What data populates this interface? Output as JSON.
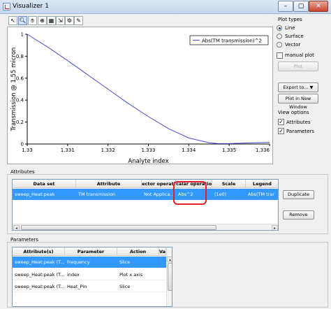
{
  "window": {
    "title": "Visualizer 1",
    "min": "–",
    "max": "▢",
    "close": "✕"
  },
  "toolbar": {
    "icons": [
      "select",
      "zoom",
      "pan",
      "copy",
      "image",
      "export",
      "settings",
      "edit"
    ]
  },
  "chart_data": {
    "type": "line",
    "xlabel": "Analyte index",
    "ylabel": "Transmission @ 1.55 micron",
    "xlim": [
      1.33,
      1.336
    ],
    "ylim": [
      0,
      1
    ],
    "xticks": [
      "1.33",
      "1.331",
      "1.332",
      "1.333",
      "1.334",
      "1.335",
      "1.336"
    ],
    "yticks": [
      "0",
      "0.2",
      "0.4",
      "0.6",
      "0.8",
      "1"
    ],
    "legend_position": "top-right",
    "series": [
      {
        "name": "Abs(TM transmission)^2",
        "color": "#4b4bd6",
        "x": [
          1.33,
          1.3305,
          1.331,
          1.3315,
          1.332,
          1.3325,
          1.333,
          1.3335,
          1.334,
          1.3345,
          1.3347,
          1.335,
          1.3355,
          1.336
        ],
        "y": [
          1.0,
          0.885,
          0.76,
          0.63,
          0.5,
          0.37,
          0.25,
          0.14,
          0.055,
          0.012,
          0.005,
          0.004,
          0.01,
          0.015
        ]
      }
    ]
  },
  "plot_types": {
    "label": "Plot types",
    "options": [
      "Line",
      "Surface",
      "Vector"
    ],
    "selected": "Line",
    "manual_plot": "manual plot",
    "plot_button": "Plot"
  },
  "actions": {
    "export": "Export to... ▼",
    "new_window": "Plot in New Window"
  },
  "view_options": {
    "label": "View options",
    "items": [
      {
        "label": "Attributes",
        "checked": true
      },
      {
        "label": "Parameters",
        "checked": true
      }
    ]
  },
  "attributes": {
    "label": "Attributes",
    "headers": [
      "Data set",
      "Attribute",
      "ector operati",
      "calar operatio",
      "Scale",
      "Legend"
    ],
    "rows": [
      [
        "sweep_Heat:peak",
        "TM transmission",
        "Not Applica...",
        "Abs^2",
        "(1e0)",
        "Abs(TM trar"
      ]
    ],
    "duplicate": "Duplicate",
    "remove": "Remove"
  },
  "parameters": {
    "label": "Parameters",
    "headers": [
      "Attribute(s)",
      "Parameter",
      "Action",
      "Va"
    ],
    "rows": [
      [
        "sweep_Heat:peak (T...",
        "frequency",
        "Slice"
      ],
      [
        "sweep_Heat:peak (T...",
        "index",
        "Plot x axis"
      ],
      [
        "sweep_Heat:peak (T...",
        "Heat_Pin",
        "Slice"
      ]
    ]
  }
}
